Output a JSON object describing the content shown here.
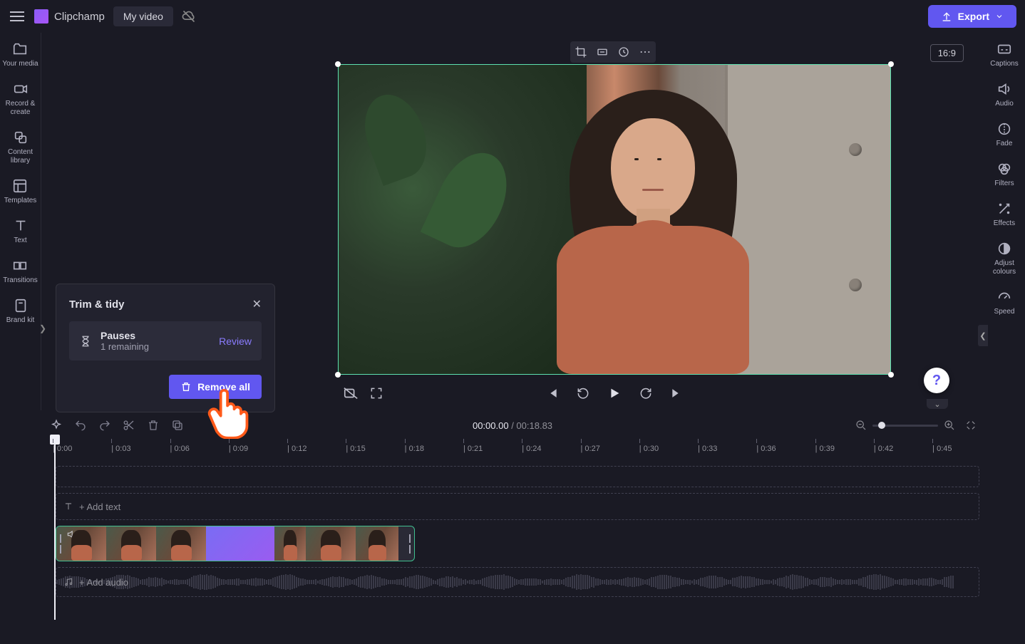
{
  "topbar": {
    "brand": "Clipchamp",
    "project_name": "My video",
    "export_label": "Export"
  },
  "left_sidebar": {
    "items": [
      {
        "label": "Your media"
      },
      {
        "label": "Record & create"
      },
      {
        "label": "Content library"
      },
      {
        "label": "Templates"
      },
      {
        "label": "Text"
      },
      {
        "label": "Transitions"
      },
      {
        "label": "Brand kit"
      }
    ]
  },
  "right_sidebar": {
    "items": [
      {
        "label": "Captions"
      },
      {
        "label": "Audio"
      },
      {
        "label": "Fade"
      },
      {
        "label": "Filters"
      },
      {
        "label": "Effects"
      },
      {
        "label": "Adjust colours"
      },
      {
        "label": "Speed"
      }
    ]
  },
  "aspect_ratio": "16:9",
  "trim_panel": {
    "title": "Trim & tidy",
    "row_title": "Pauses",
    "row_sub": "1 remaining",
    "review": "Review",
    "remove_all": "Remove all"
  },
  "playback": {
    "current": "00:00.00",
    "duration": "00:18.83",
    "separator": " / "
  },
  "tracks": {
    "text_placeholder": "+ Add text",
    "audio_placeholder": "+ Add audio"
  },
  "ruler": [
    "0:00",
    "0:03",
    "0:06",
    "0:09",
    "0:12",
    "0:15",
    "0:18",
    "0:21",
    "0:24",
    "0:27",
    "0:30",
    "0:33",
    "0:36",
    "0:39",
    "0:42",
    "0:45"
  ],
  "help": "?"
}
